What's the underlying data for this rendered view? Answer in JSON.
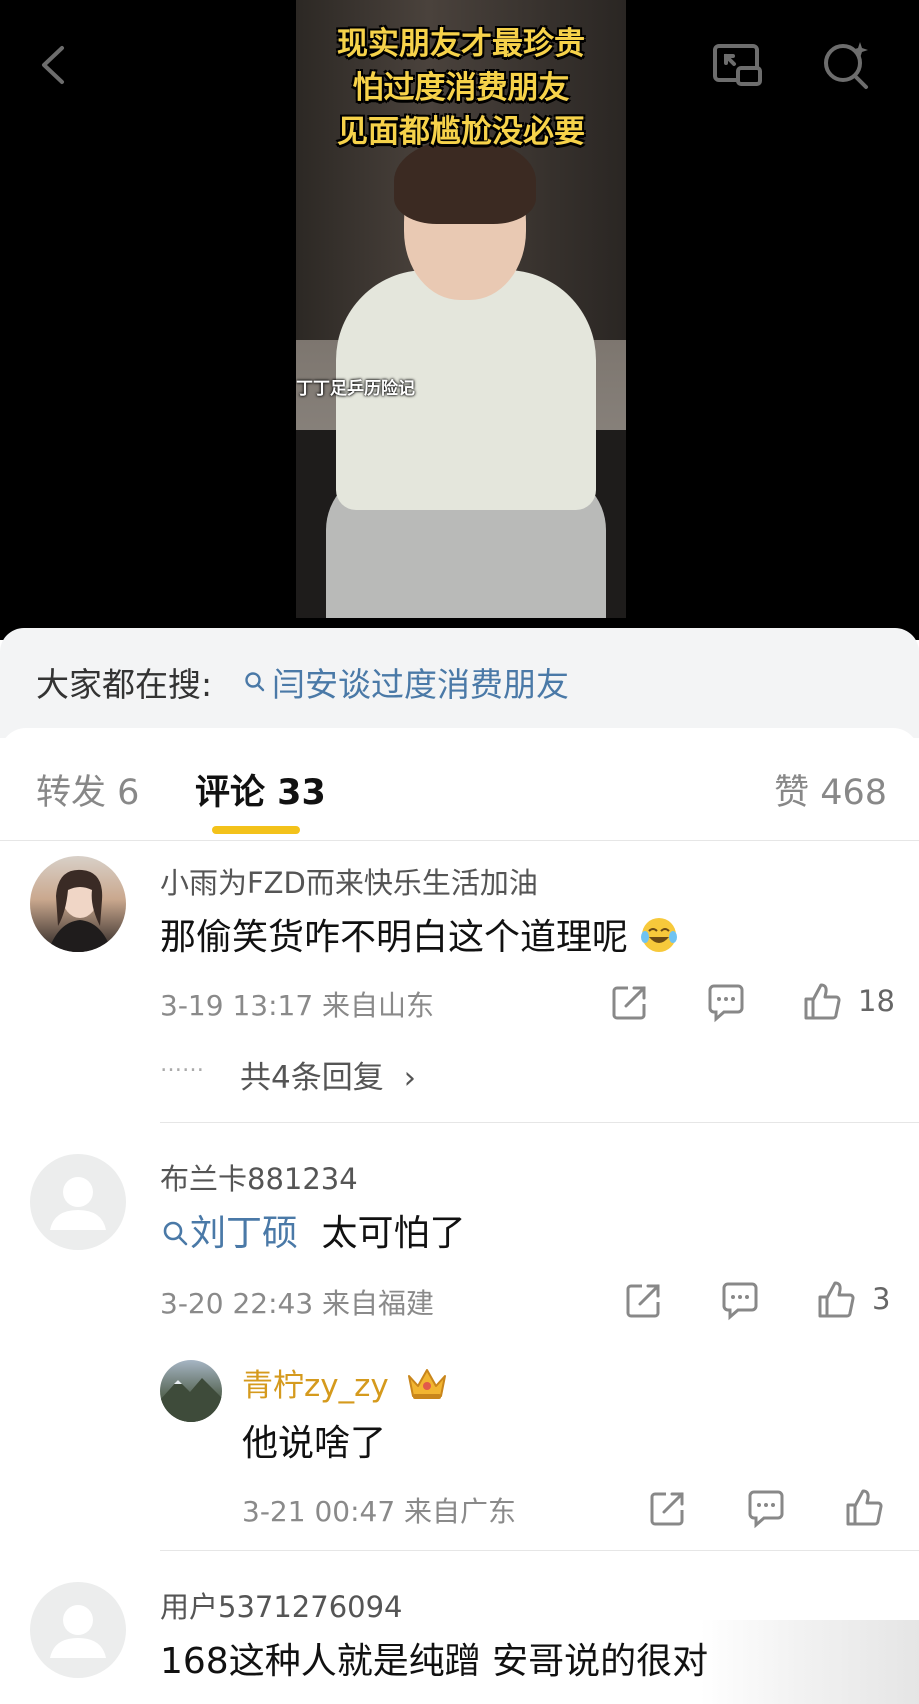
{
  "video": {
    "caption": [
      "现实朋友才最珍贵",
      "怕过度消费朋友",
      "见面都尴尬没必要"
    ],
    "watermark": "丁丁足乒历险记"
  },
  "nav": {
    "back_icon": "back-arrow-icon",
    "cast_icon": "picture-in-picture-icon",
    "search_icon": "search-sparkle-icon"
  },
  "suggest": {
    "label": "大家都在搜:",
    "query": "闫安谈过度消费朋友"
  },
  "tabs": {
    "repost": "转发 6",
    "comments": "评论 33",
    "likes": "赞 468",
    "underline_color": "#f3c21a"
  },
  "comments": [
    {
      "user": "小雨为FZD而来快乐生活加油",
      "text": "那偷笑货咋不明白这个道理呢",
      "emoji": "laughing-crying-emoji",
      "time": "3-19 13:17  来自山东",
      "likes": "18",
      "replies": "共4条回复",
      "replies_dots": "……"
    },
    {
      "user": "布兰卡881234",
      "topic": "刘丁硕",
      "text": "太可怕了",
      "time": "3-20 22:43  来自福建",
      "likes": "3",
      "reply": {
        "user": "青柠zy_zy",
        "badge": "crown-badge",
        "text": "他说啥了",
        "time": "3-21 00:47  来自广东"
      }
    },
    {
      "user": "用户5371276094",
      "text": "168这种人就是纯蹭 安哥说的很对"
    }
  ],
  "colors": {
    "link": "#4a79a7",
    "vip": "#d59a1d",
    "accent": "#f3c21a"
  }
}
